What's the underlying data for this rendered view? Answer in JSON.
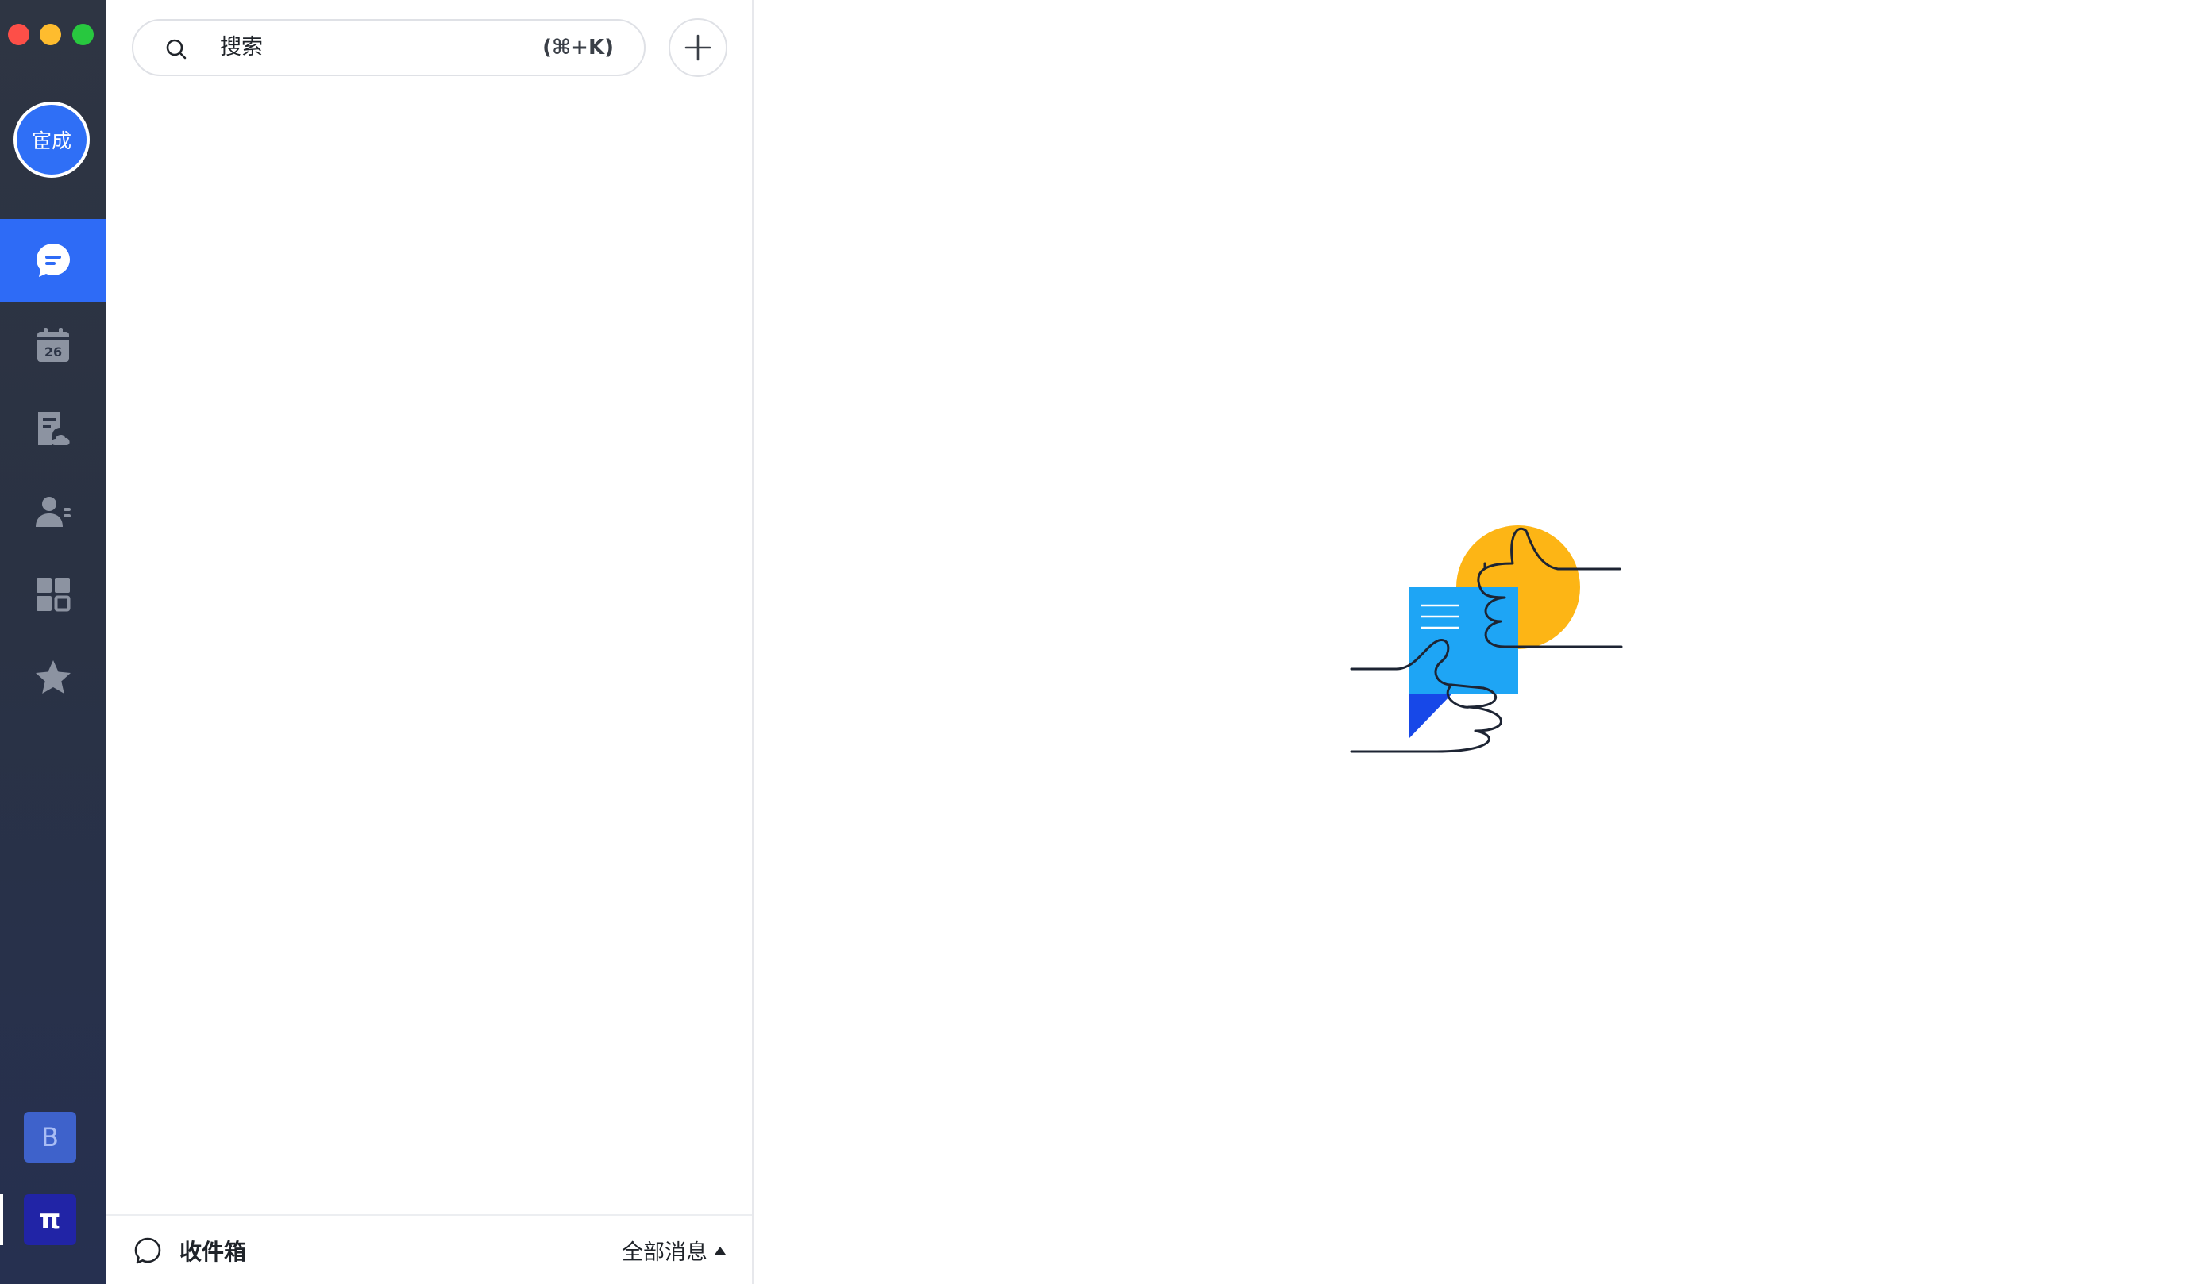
{
  "window": {
    "controls": [
      "close",
      "minimize",
      "maximize"
    ]
  },
  "rail": {
    "user_avatar_text": "宦成",
    "nav_items": [
      {
        "icon": "chat-bubble-icon",
        "active": true
      },
      {
        "icon": "calendar-icon",
        "date_text": "26",
        "active": false
      },
      {
        "icon": "cloud-document-icon",
        "active": false
      },
      {
        "icon": "contacts-icon",
        "active": false
      },
      {
        "icon": "workplace-grid-icon",
        "active": false
      },
      {
        "icon": "star-icon",
        "active": false
      }
    ],
    "workspaces": [
      {
        "label": "B"
      },
      {
        "label": "π",
        "active": true
      }
    ]
  },
  "list": {
    "search": {
      "placeholder": "搜索",
      "shortcut": "(⌘+K)"
    },
    "add_icon": "plus-icon",
    "footer": {
      "inbox_label": "收件箱",
      "filter_label": "全部消息"
    }
  },
  "colors": {
    "accent": "#2e6bf6",
    "rail_bg": "#2b3244",
    "illustration_yellow": "#fdb515",
    "illustration_blue": "#1ea5f5",
    "illustration_dark_blue": "#1748e8"
  }
}
